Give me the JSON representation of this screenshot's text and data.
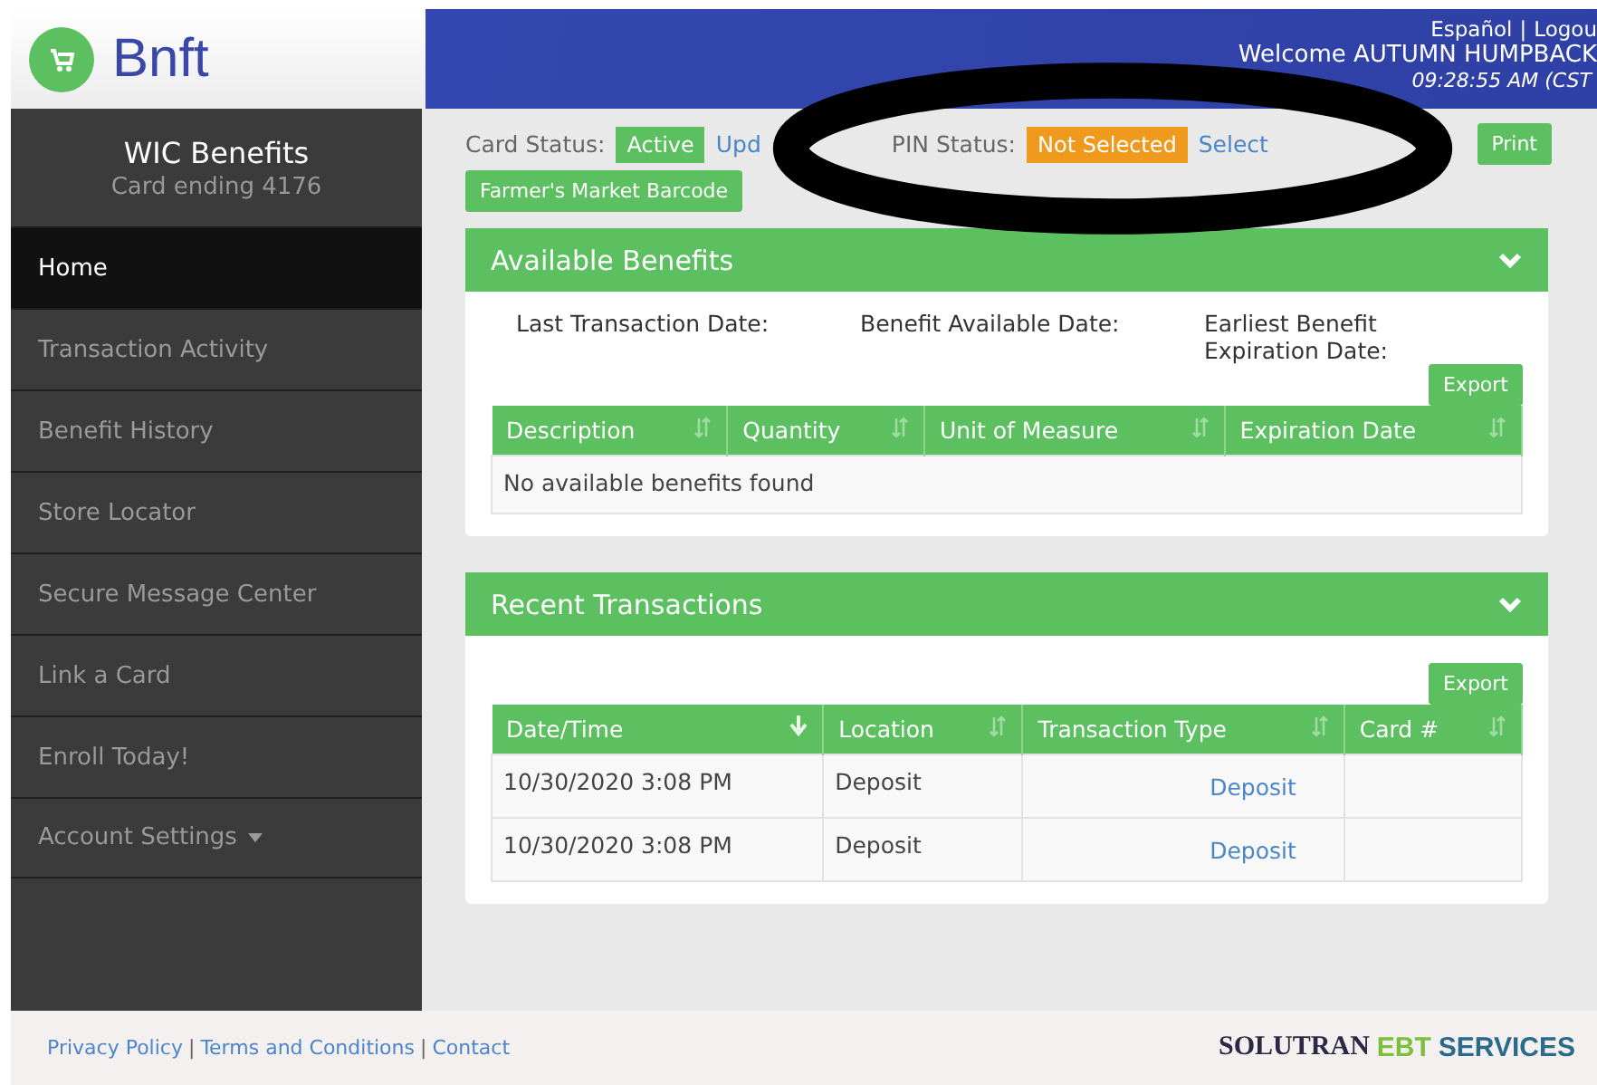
{
  "header": {
    "logo": "Bnft",
    "links": [
      "Español",
      "Logou"
    ],
    "separator": "|",
    "welcome": "Welcome AUTUMN HUMPBACK",
    "time": "09:28:55 AM (CST"
  },
  "sidebar": {
    "title": "WIC Benefits",
    "subtitle": "Card ending 4176",
    "items": [
      {
        "label": "Home",
        "selected": true,
        "dropdown": false
      },
      {
        "label": "Transaction Activity",
        "selected": false,
        "dropdown": false
      },
      {
        "label": "Benefit History",
        "selected": false,
        "dropdown": false
      },
      {
        "label": "Store Locator",
        "selected": false,
        "dropdown": false
      },
      {
        "label": "Secure Message Center",
        "selected": false,
        "dropdown": false
      },
      {
        "label": "Link a Card",
        "selected": false,
        "dropdown": false
      },
      {
        "label": "Enroll Today!",
        "selected": false,
        "dropdown": false
      },
      {
        "label": "Account Settings",
        "selected": false,
        "dropdown": true
      }
    ]
  },
  "status": {
    "card_label": "Card Status:",
    "card_status": "Active",
    "card_link": "Upd",
    "pin_label": "PIN Status:",
    "pin_status": "Not Selected",
    "pin_link": "Select",
    "print": "Print",
    "barcode": "Farmer's Market Barcode"
  },
  "benefits": {
    "title": "Available Benefits",
    "expanded": true,
    "dates": [
      "Last Transaction Date:",
      "Benefit Available Date:",
      "Earliest Benefit Expiration Date:"
    ],
    "export": "Export",
    "columns": [
      {
        "label": "Description",
        "sorted": false
      },
      {
        "label": "Quantity",
        "sorted": false
      },
      {
        "label": "Unit of Measure",
        "sorted": false
      },
      {
        "label": "Expiration Date",
        "sorted": false
      }
    ],
    "empty": "No available benefits found"
  },
  "transactions": {
    "title": "Recent Transactions",
    "expanded": true,
    "export": "Export",
    "columns": [
      {
        "label": "Date/Time",
        "sorted": true
      },
      {
        "label": "Location",
        "sorted": false
      },
      {
        "label": "Transaction Type",
        "sorted": false
      },
      {
        "label": "Card #",
        "sorted": false
      }
    ],
    "rows": [
      [
        "10/30/2020 3:08 PM",
        "Deposit",
        "Deposit"
      ],
      [
        "10/30/2020 3:08 PM",
        "Deposit",
        "Deposit"
      ]
    ]
  },
  "footer": {
    "links": [
      "Privacy Policy",
      "Terms and Conditions",
      "Contact"
    ],
    "separator": "|",
    "brand": [
      "SOLUTRAN",
      "EBT",
      "SERVICES"
    ]
  }
}
